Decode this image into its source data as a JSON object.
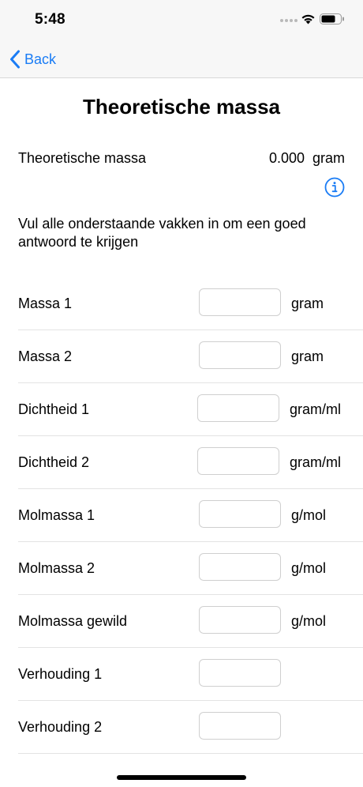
{
  "status_bar": {
    "time": "5:48"
  },
  "nav": {
    "back_label": "Back",
    "accent_color": "#1a7cf5"
  },
  "page": {
    "title": "Theoretische massa"
  },
  "result": {
    "label": "Theoretische massa",
    "value": "0.000",
    "unit": "gram"
  },
  "instruction": "Vul alle onderstaande vakken in om een goed antwoord te krijgen",
  "fields": [
    {
      "label": "Massa 1",
      "unit": "gram",
      "value": ""
    },
    {
      "label": "Massa 2",
      "unit": "gram",
      "value": ""
    },
    {
      "label": "Dichtheid 1",
      "unit": "gram/ml",
      "value": ""
    },
    {
      "label": "Dichtheid 2",
      "unit": "gram/ml",
      "value": ""
    },
    {
      "label": "Molmassa 1",
      "unit": "g/mol",
      "value": ""
    },
    {
      "label": "Molmassa 2",
      "unit": "g/mol",
      "value": ""
    },
    {
      "label": "Molmassa gewild",
      "unit": "g/mol",
      "value": ""
    },
    {
      "label": "Verhouding 1",
      "unit": "",
      "value": ""
    },
    {
      "label": "Verhouding 2",
      "unit": "",
      "value": ""
    }
  ]
}
